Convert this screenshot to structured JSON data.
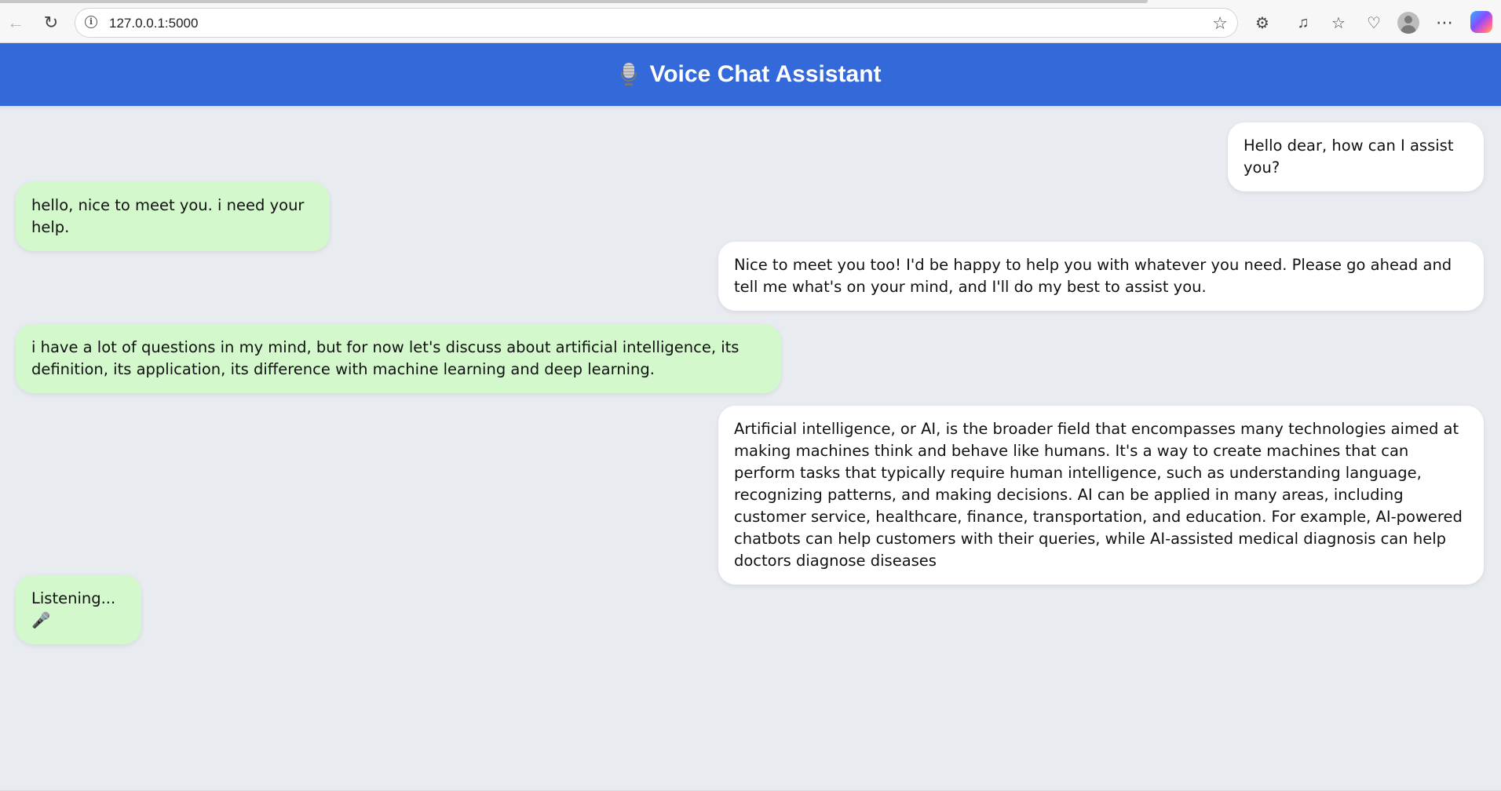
{
  "browser": {
    "url": "127.0.0.1:5000",
    "icons": [
      "back-arrow-icon",
      "reload-icon",
      "info-icon",
      "star-icon",
      "extensions-icon",
      "media-icon",
      "favorites-icon",
      "health-icon",
      "profile-icon",
      "more-icon",
      "copilot-icon"
    ]
  },
  "header": {
    "title": "Voice Chat Assistant",
    "icon": "studio-microphone-icon",
    "color": "#3369d8"
  },
  "colors": {
    "background": "#e8ebf0",
    "bot_bubble": "#ffffff",
    "user_bubble": "#d3f8cc"
  },
  "messages": [
    {
      "sender": "bot",
      "text": "Hello dear, how can I assist you?"
    },
    {
      "sender": "user",
      "text": "hello, nice to meet you. i need your help."
    },
    {
      "sender": "bot",
      "text": "Nice to meet you too! I'd be happy to help you with whatever you need. Please go ahead and tell me what's on your mind, and I'll do my best to assist you."
    },
    {
      "sender": "user",
      "text": "i have a lot of questions in my mind, but for now let's discuss about artificial intelligence, its definition, its application, its difference with machine learning and deep learning."
    },
    {
      "sender": "bot",
      "text": "Artificial intelligence, or AI, is the broader field that encompasses many technologies aimed at making machines think and behave like humans. It's a way to create machines that can perform tasks that typically require human intelligence, such as understanding language, recognizing patterns, and making decisions. AI can be applied in many areas, including customer service, healthcare, finance, transportation, and education. For example, AI-powered chatbots can help customers with their queries, while AI-assisted medical diagnosis can help doctors diagnose diseases"
    },
    {
      "sender": "user",
      "text": "Listening...🎤"
    }
  ]
}
